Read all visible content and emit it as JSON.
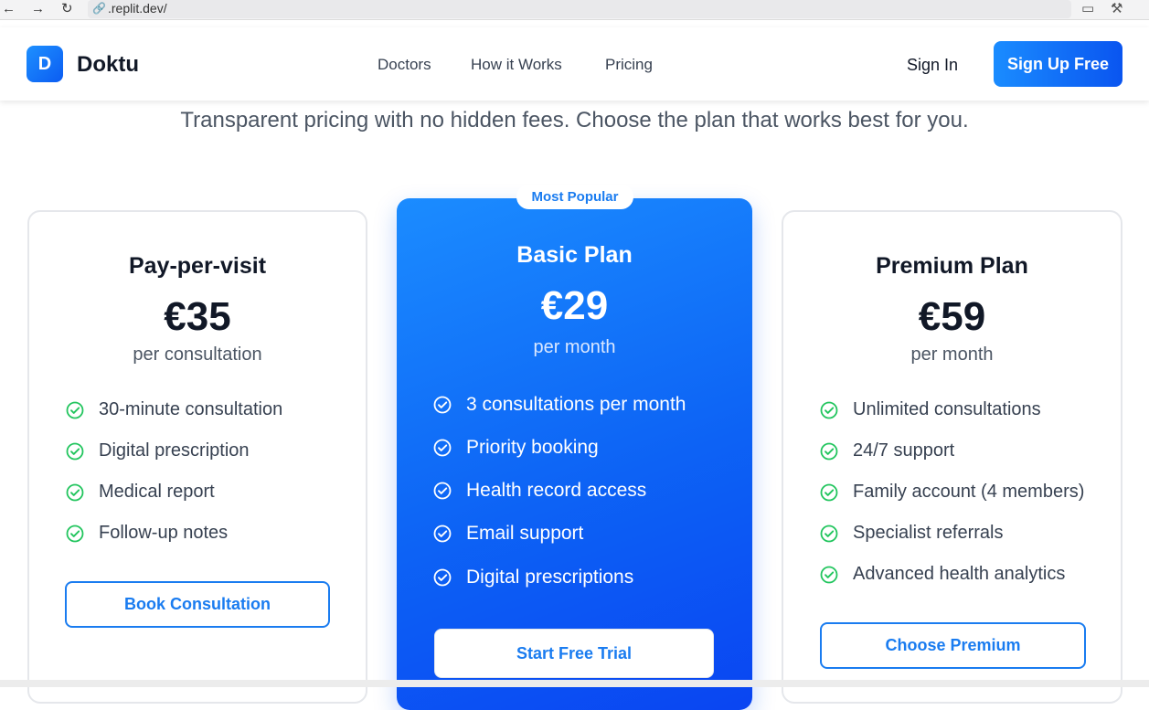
{
  "browser": {
    "url": ".replit.dev/",
    "icons": [
      "back-arrow-icon",
      "forward-arrow-icon",
      "reload-icon",
      "link-icon",
      "devices-icon",
      "wrench-icon"
    ]
  },
  "header": {
    "logo_letter": "D",
    "brand": "Doktu",
    "nav": [
      "Doctors",
      "How it Works",
      "Pricing"
    ],
    "sign_in": "Sign In",
    "sign_up": "Sign Up Free"
  },
  "subtitle": "Transparent pricing with no hidden fees. Choose the plan that works best for you.",
  "plans": [
    {
      "title": "Pay-per-visit",
      "price": "€35",
      "period": "per consultation",
      "features": [
        "30-minute consultation",
        "Digital prescription",
        "Medical report",
        "Follow-up notes"
      ],
      "button": "Book Consultation"
    },
    {
      "badge": "Most Popular",
      "title": "Basic Plan",
      "price": "€29",
      "period": "per month",
      "features": [
        "3 consultations per month",
        "Priority booking",
        "Health record access",
        "Email support",
        "Digital prescriptions"
      ],
      "button": "Start Free Trial"
    },
    {
      "title": "Premium Plan",
      "price": "€59",
      "period": "per month",
      "features": [
        "Unlimited consultations",
        "24/7 support",
        "Family account (4 members)",
        "Specialist referrals",
        "Advanced health analytics"
      ],
      "button": "Choose Premium"
    }
  ],
  "colors": {
    "accent": "#1a7cf0",
    "check_green": "#22c55e"
  }
}
